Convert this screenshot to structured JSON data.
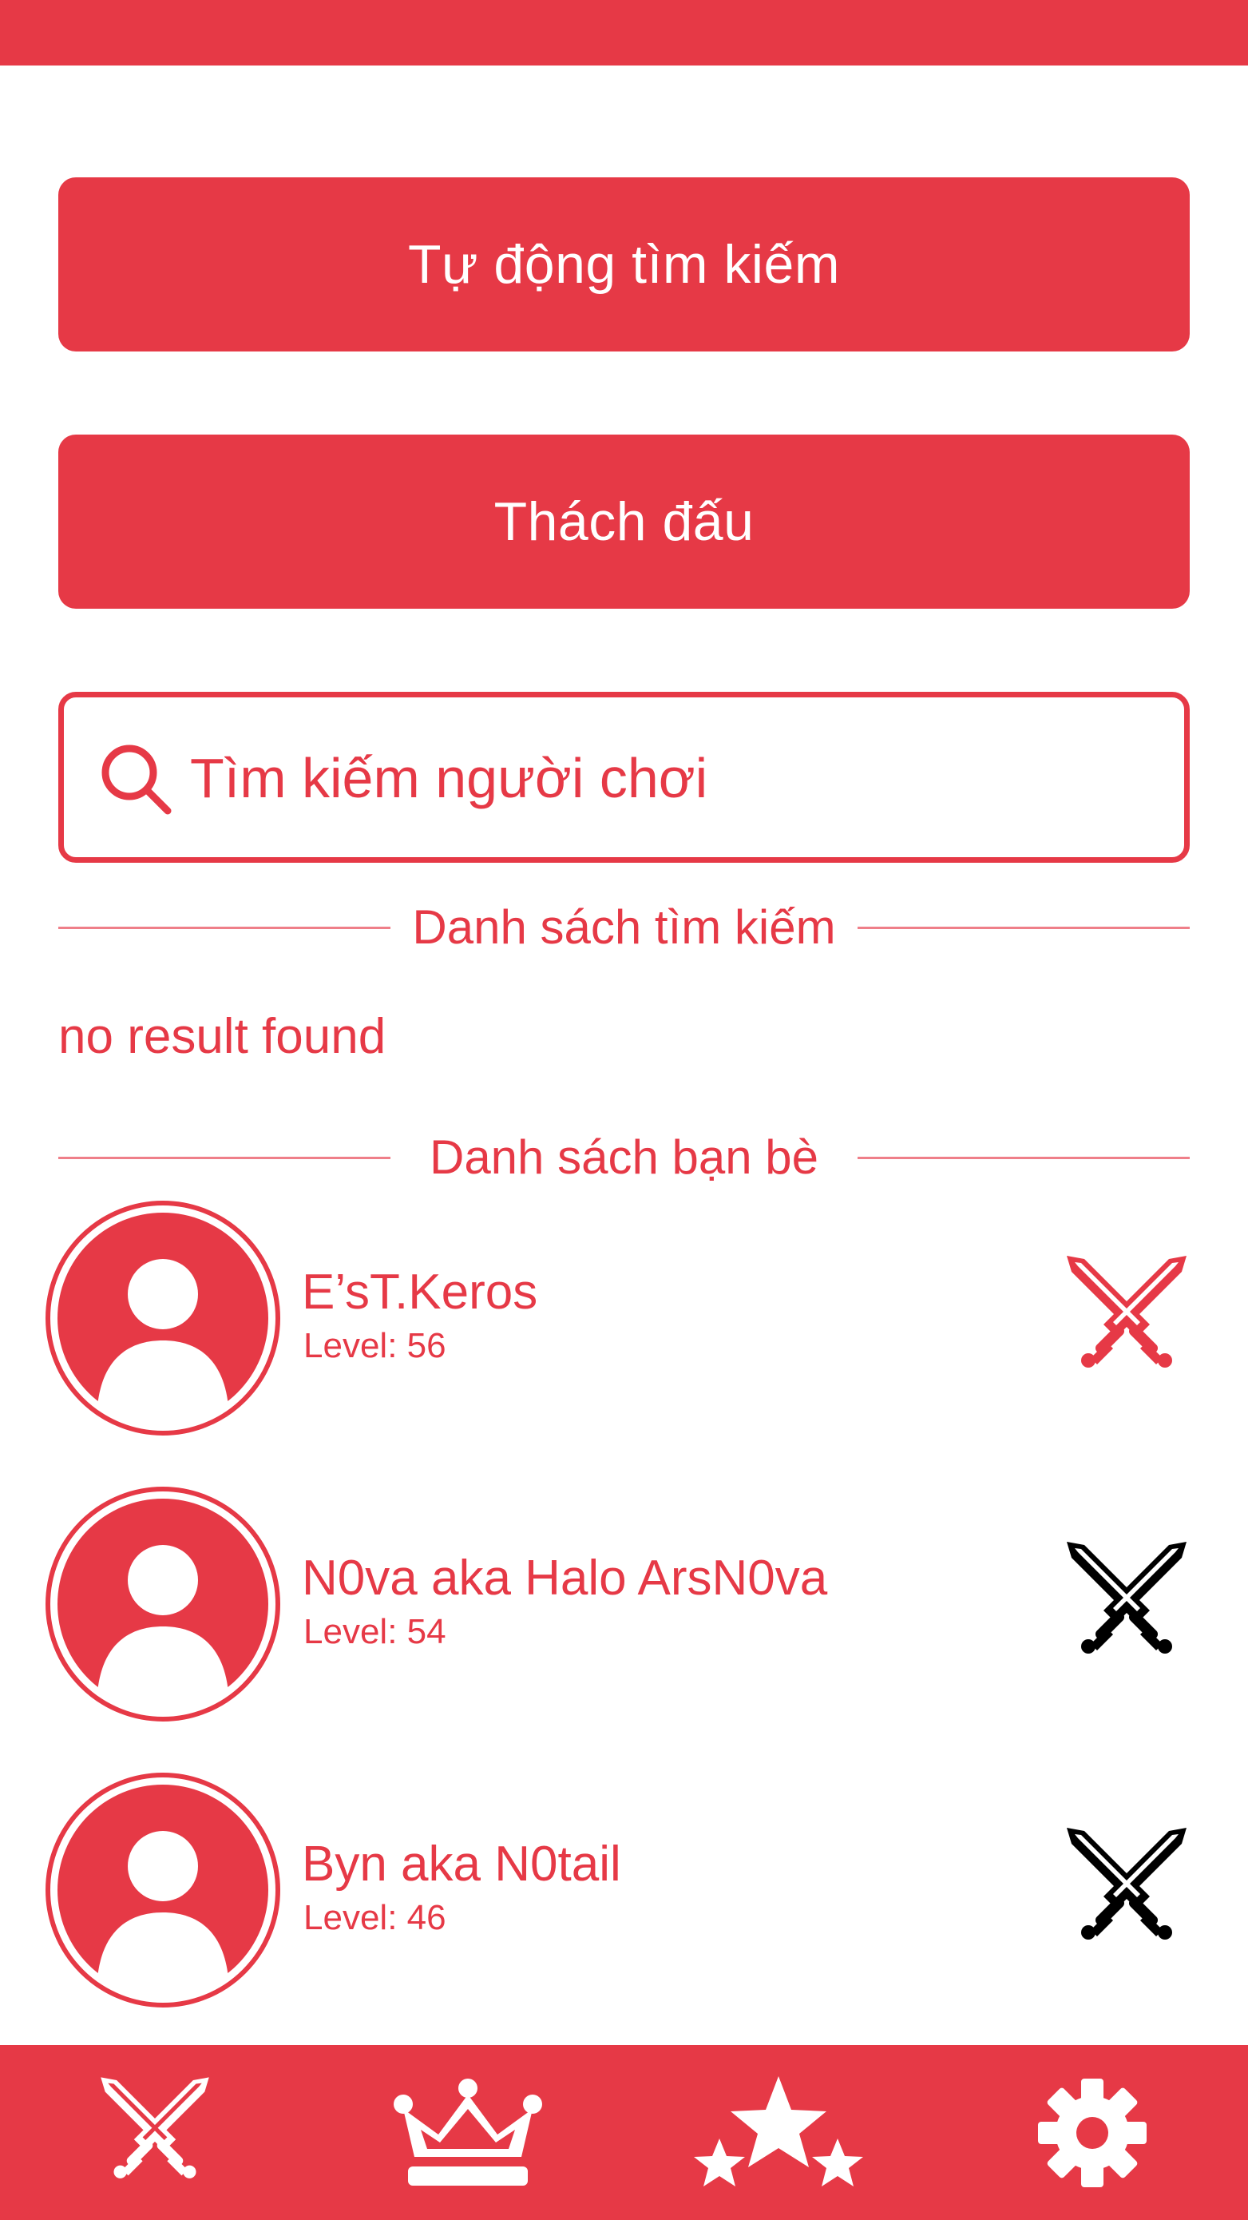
{
  "theme": {
    "primary": "#e63946",
    "divider": "#ef7f89",
    "background": "#ffffff",
    "challenge_active": "#e63946",
    "challenge_inactive": "#000000"
  },
  "actions": {
    "auto_search_label": "Tự động tìm kiếm",
    "challenge_label": "Thách đấu"
  },
  "search": {
    "icon": "search-icon",
    "placeholder": "Tìm kiếm người chơi",
    "value": ""
  },
  "search_results": {
    "heading": "Danh sách tìm kiếm",
    "empty_text": "no result found"
  },
  "friends": {
    "heading": "Danh sách bạn bè",
    "items": [
      {
        "name": "E’sT.Keros",
        "level": "Level: 56",
        "avatar_icon": "user-avatar-icon",
        "challenge_icon": "crossed-swords-icon",
        "challenge_active": true
      },
      {
        "name": "N0va aka Halo ArsN0va",
        "level": "Level: 54",
        "avatar_icon": "user-avatar-icon",
        "challenge_icon": "crossed-swords-icon",
        "challenge_active": false
      },
      {
        "name": "Byn aka N0tail",
        "level": "Level: 46",
        "avatar_icon": "user-avatar-icon",
        "challenge_icon": "crossed-swords-icon",
        "challenge_active": false
      }
    ]
  },
  "bottom_nav": [
    {
      "icon": "crossed-swords-icon"
    },
    {
      "icon": "crown-icon"
    },
    {
      "icon": "stars-icon"
    },
    {
      "icon": "gear-icon"
    }
  ]
}
